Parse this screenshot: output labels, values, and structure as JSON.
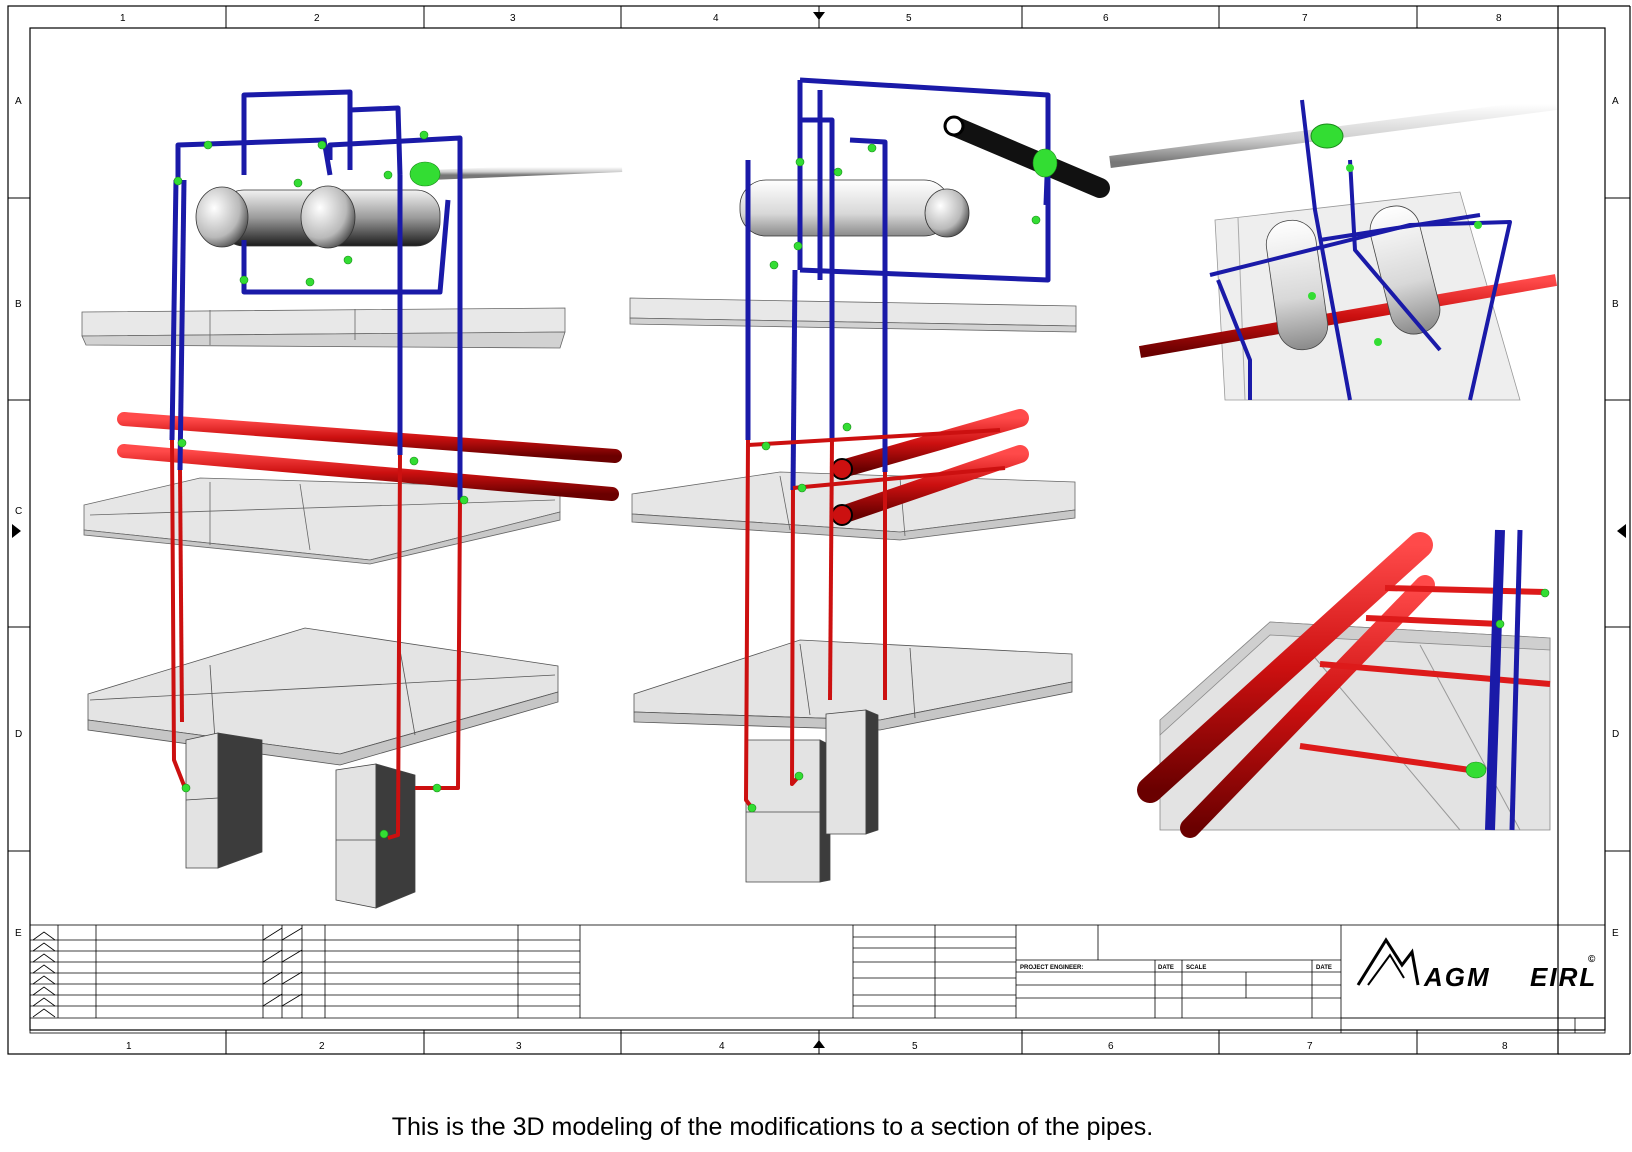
{
  "sheet": {
    "columns_top": [
      "1",
      "2",
      "3",
      "4",
      "5",
      "6",
      "7",
      "8"
    ],
    "columns_bottom": [
      "1",
      "2",
      "3",
      "4",
      "5",
      "6",
      "7",
      "8"
    ],
    "rows": [
      "A",
      "B",
      "C",
      "D",
      "E"
    ],
    "row_labels_right": [
      "A",
      "B",
      "D",
      "E"
    ]
  },
  "title_block": {
    "project_engineer": "PROJECT ENGINEER:",
    "date_1": "DATE",
    "scale": "SCALE",
    "date_2": "DATE",
    "company_left": "AGM",
    "company_right": "EIRL",
    "copyright": "©"
  },
  "colors": {
    "cold_pipe": "#1a1aa8",
    "hot_pipe": "#cc1010",
    "fitting": "#33dd33",
    "structure": "#cfcfcf"
  },
  "caption": "This is the 3D modeling of the modifications to a section of the pipes."
}
